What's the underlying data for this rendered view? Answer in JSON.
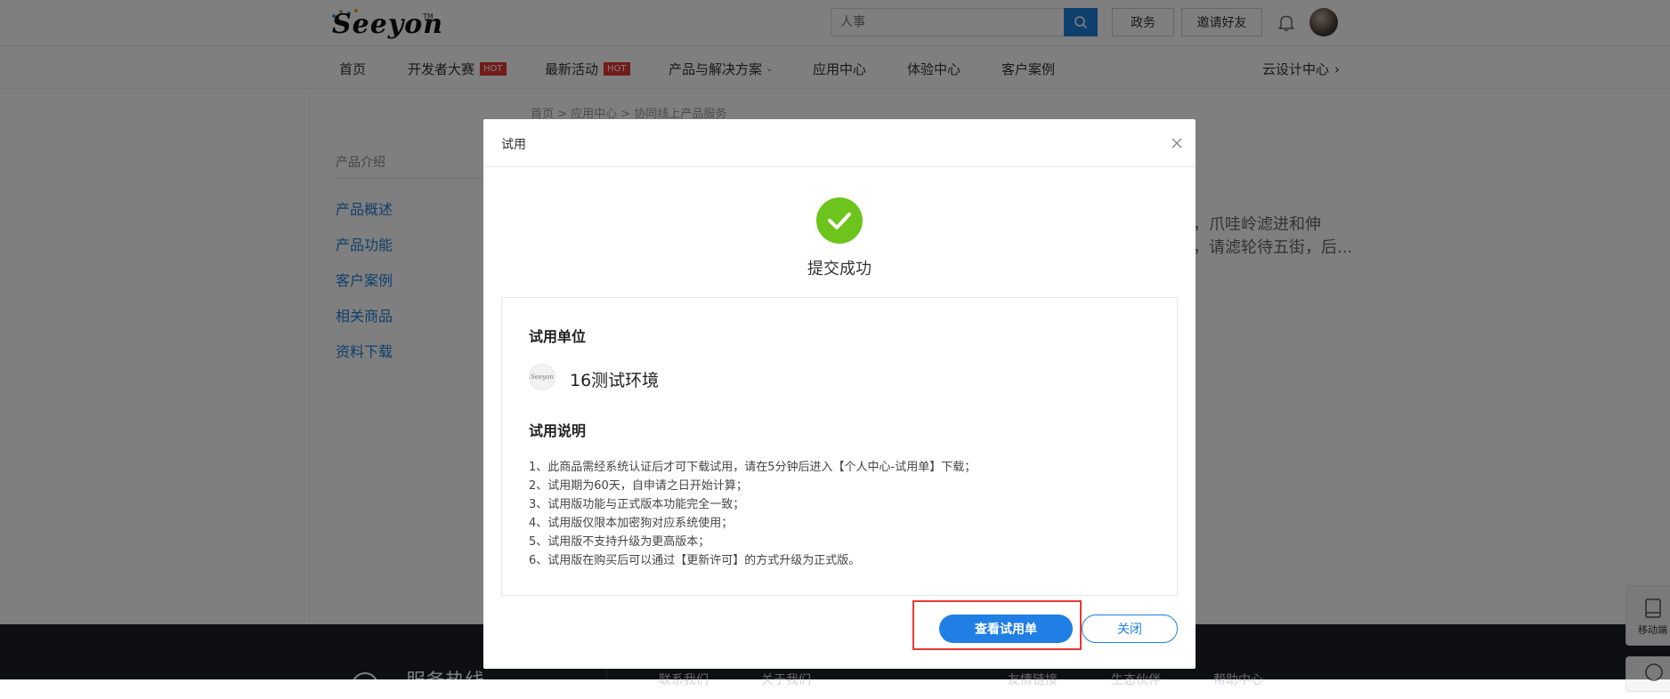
{
  "header": {
    "logo_text": "Seeyon",
    "logo_tm": "TM",
    "search": {
      "placeholder": "人事"
    },
    "buttons": {
      "government": "政务",
      "invite": "邀请好友"
    }
  },
  "nav": {
    "items": [
      {
        "label": "首页"
      },
      {
        "label": "开发者大赛",
        "badge": "HOT"
      },
      {
        "label": "最新活动",
        "badge": "HOT"
      },
      {
        "label": "产品与解决方案"
      },
      {
        "label": "应用中心"
      },
      {
        "label": "体验中心"
      },
      {
        "label": "客户案例"
      }
    ],
    "right": {
      "label": "云设计中心",
      "chevron": "›"
    }
  },
  "sidebar": {
    "title": "产品介绍",
    "links": [
      "产品概述",
      "产品功能",
      "客户案例",
      "相关商品",
      "资料下载"
    ]
  },
  "background": {
    "breadcrumb": "首页 > 应用中心 > 协同线上产品服务",
    "text_line1": "，爪哇岭滤进和伸",
    "text_line2": "，请滤轮待五街，后..."
  },
  "modal": {
    "title": "试用",
    "success_text": "提交成功",
    "unit_section_title": "试用单位",
    "unit_logo_text": "Seeyon",
    "unit_name": "16测试环境",
    "notes_section_title": "试用说明",
    "notes": [
      "1、此商品需经系统认证后才可下载试用，请在5分钟后进入【个人中心-试用单】下载；",
      "2、试用期为60天，自申请之日开始计算；",
      "3、试用版功能与正式版本功能完全一致；",
      "4、试用版仅限本加密狗对应系统使用；",
      "5、试用版不支持升级为更高版本；",
      "6、试用版在购买后可以通过【更新许可】的方式升级为正式版。"
    ],
    "primary_button": "查看试用单",
    "close_button": "关闭"
  },
  "footer": {
    "hotline": "服务热线",
    "links": [
      "联系我们",
      "关于我们",
      "友情链接",
      "生态伙伴",
      "帮助中心"
    ]
  },
  "floating": {
    "mobile_label": "移动端"
  },
  "colors": {
    "accent": "#1f7fe5",
    "success": "#6cc41c",
    "hot_badge": "#e53935",
    "highlight_border": "#e53935"
  }
}
